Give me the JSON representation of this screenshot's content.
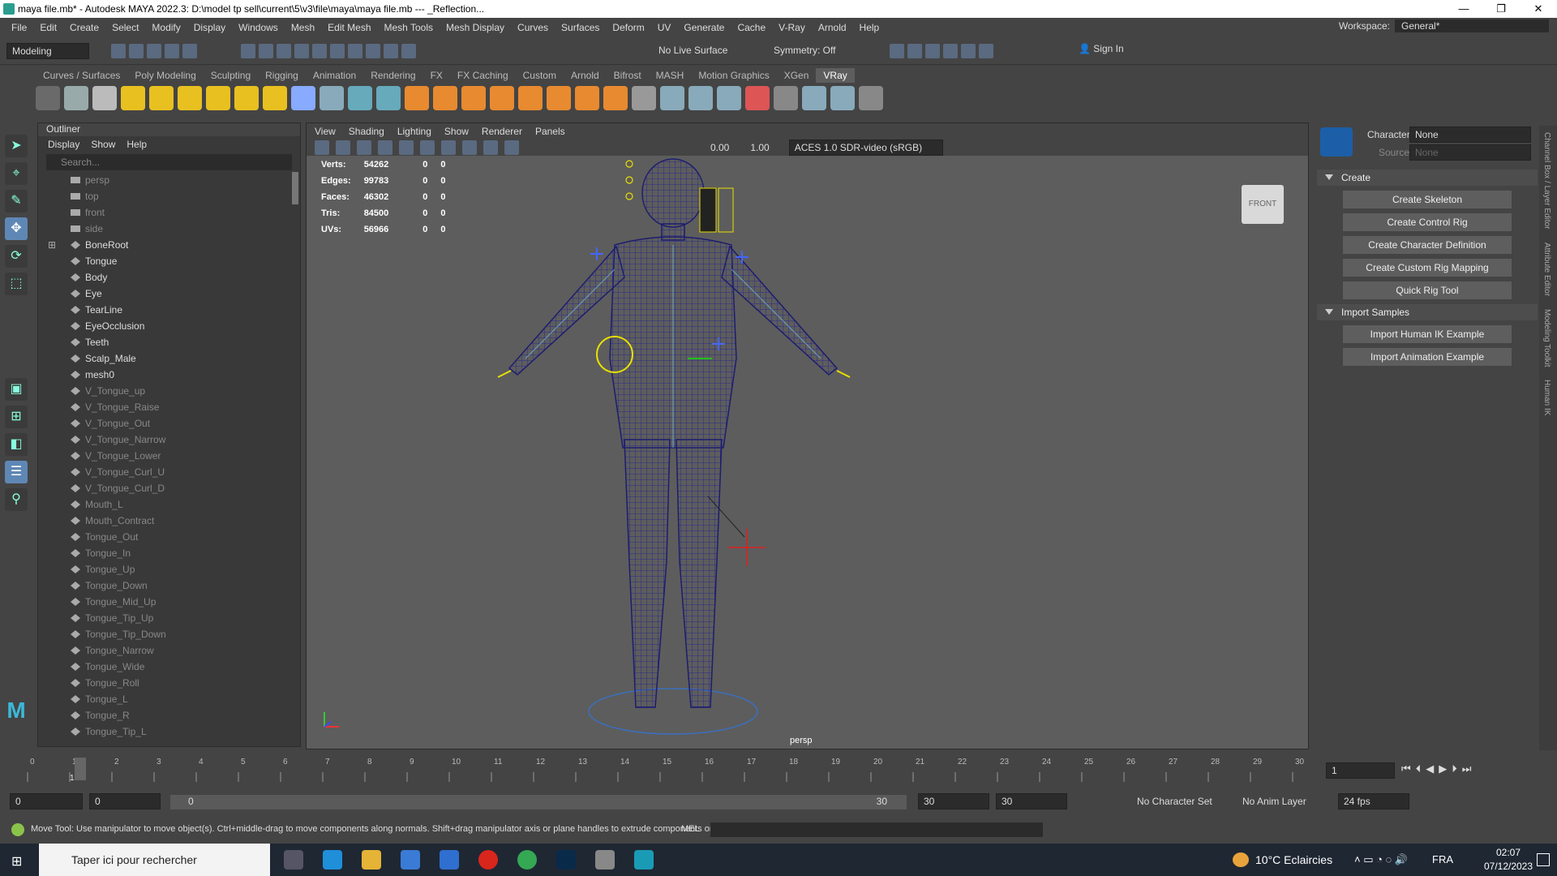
{
  "window": {
    "title": "maya file.mb* - Autodesk MAYA 2022.3: D:\\model tp sell\\current\\5\\v3\\file\\maya\\maya file.mb  ---  _Reflection...",
    "controls": [
      "—",
      "❐",
      "✕"
    ]
  },
  "menubar": {
    "items": [
      "File",
      "Edit",
      "Create",
      "Select",
      "Modify",
      "Display",
      "Windows",
      "Mesh",
      "Edit Mesh",
      "Mesh Tools",
      "Mesh Display",
      "Curves",
      "Surfaces",
      "Deform",
      "UV",
      "Generate",
      "Cache",
      "V-Ray",
      "Arnold",
      "Help"
    ],
    "workspace_label": "Workspace:",
    "workspace_value": "General*"
  },
  "statusline": {
    "mode": "Modeling",
    "live_surface": "No Live Surface",
    "symmetry": "Symmetry: Off",
    "sign_in": "Sign In"
  },
  "shelf": {
    "tabs": [
      "Curves / Surfaces",
      "Poly Modeling",
      "Sculpting",
      "Rigging",
      "Animation",
      "Rendering",
      "FX",
      "FX Caching",
      "Custom",
      "Arnold",
      "Bifrost",
      "MASH",
      "Motion Graphics",
      "XGen",
      "VRay"
    ],
    "active": "VRay"
  },
  "outliner": {
    "title": "Outliner",
    "menu": [
      "Display",
      "Show",
      "Help"
    ],
    "search_placeholder": "Search...",
    "items": [
      {
        "label": "persp",
        "kind": "cam",
        "dim": true
      },
      {
        "label": "top",
        "kind": "cam",
        "dim": true
      },
      {
        "label": "front",
        "kind": "cam",
        "dim": true
      },
      {
        "label": "side",
        "kind": "cam",
        "dim": true
      },
      {
        "label": "BoneRoot",
        "kind": "joint"
      },
      {
        "label": "Tongue",
        "kind": "mesh"
      },
      {
        "label": "Body",
        "kind": "mesh"
      },
      {
        "label": "Eye",
        "kind": "mesh"
      },
      {
        "label": "TearLine",
        "kind": "mesh"
      },
      {
        "label": "EyeOcclusion",
        "kind": "mesh"
      },
      {
        "label": "Teeth",
        "kind": "mesh"
      },
      {
        "label": "Scalp_Male",
        "kind": "mesh"
      },
      {
        "label": "mesh0",
        "kind": "mesh"
      },
      {
        "label": "V_Tongue_up",
        "kind": "mesh",
        "dim": true
      },
      {
        "label": "V_Tongue_Raise",
        "kind": "mesh",
        "dim": true
      },
      {
        "label": "V_Tongue_Out",
        "kind": "mesh",
        "dim": true
      },
      {
        "label": "V_Tongue_Narrow",
        "kind": "mesh",
        "dim": true
      },
      {
        "label": "V_Tongue_Lower",
        "kind": "mesh",
        "dim": true
      },
      {
        "label": "V_Tongue_Curl_U",
        "kind": "mesh",
        "dim": true
      },
      {
        "label": "V_Tongue_Curl_D",
        "kind": "mesh",
        "dim": true
      },
      {
        "label": "Mouth_L",
        "kind": "mesh",
        "dim": true
      },
      {
        "label": "Mouth_Contract",
        "kind": "mesh",
        "dim": true
      },
      {
        "label": "Tongue_Out",
        "kind": "mesh",
        "dim": true
      },
      {
        "label": "Tongue_In",
        "kind": "mesh",
        "dim": true
      },
      {
        "label": "Tongue_Up",
        "kind": "mesh",
        "dim": true
      },
      {
        "label": "Tongue_Down",
        "kind": "mesh",
        "dim": true
      },
      {
        "label": "Tongue_Mid_Up",
        "kind": "mesh",
        "dim": true
      },
      {
        "label": "Tongue_Tip_Up",
        "kind": "mesh",
        "dim": true
      },
      {
        "label": "Tongue_Tip_Down",
        "kind": "mesh",
        "dim": true
      },
      {
        "label": "Tongue_Narrow",
        "kind": "mesh",
        "dim": true
      },
      {
        "label": "Tongue_Wide",
        "kind": "mesh",
        "dim": true
      },
      {
        "label": "Tongue_Roll",
        "kind": "mesh",
        "dim": true
      },
      {
        "label": "Tongue_L",
        "kind": "mesh",
        "dim": true
      },
      {
        "label": "Tongue_R",
        "kind": "mesh",
        "dim": true
      },
      {
        "label": "Tongue_Tip_L",
        "kind": "mesh",
        "dim": true
      }
    ]
  },
  "viewport": {
    "menu": [
      "View",
      "Shading",
      "Lighting",
      "Show",
      "Renderer",
      "Panels"
    ],
    "exposure": "0.00",
    "gamma": "1.00",
    "colorspace": "ACES 1.0 SDR-video (sRGB)",
    "camera_label": "persp",
    "view_cube": "FRONT",
    "stats": [
      [
        "Verts:",
        "54262",
        "0",
        "0"
      ],
      [
        "Edges:",
        "99783",
        "0",
        "0"
      ],
      [
        "Faces:",
        "46302",
        "0",
        "0"
      ],
      [
        "Tris:",
        "84500",
        "0",
        "0"
      ],
      [
        "UVs:",
        "56966",
        "0",
        "0"
      ]
    ]
  },
  "hik": {
    "character_label": "Character:",
    "character_value": "None",
    "source_label": "Source:",
    "source_value": "None",
    "create_title": "Create",
    "create_buttons": [
      "Create Skeleton",
      "Create Control Rig",
      "Create Character Definition",
      "Create Custom Rig Mapping",
      "Quick Rig Tool"
    ],
    "import_title": "Import Samples",
    "import_buttons": [
      "Import Human IK Example",
      "Import Animation Example"
    ],
    "side_tabs": [
      "Channel Box / Layer Editor",
      "Attribute Editor",
      "Modeling Toolkit",
      "Human IK"
    ]
  },
  "timeslider": {
    "ticks": [
      "0",
      "1",
      "2",
      "3",
      "4",
      "5",
      "6",
      "7",
      "8",
      "9",
      "10",
      "11",
      "12",
      "13",
      "14",
      "15",
      "16",
      "17",
      "18",
      "19",
      "20",
      "21",
      "22",
      "23",
      "24",
      "25",
      "26",
      "27",
      "28",
      "29",
      "30"
    ],
    "current": "1",
    "current_field": "1"
  },
  "range": {
    "start": "0",
    "start2": "0",
    "slider_start": "0",
    "slider_end": "30",
    "end": "30",
    "end2": "30",
    "character_set": "No Character Set",
    "anim_layer": "No Anim Layer",
    "fps": "24 fps"
  },
  "help_line": {
    "text": "Move Tool: Use manipulator to move object(s). Ctrl+middle-drag to move components along normals. Shift+drag manipulator axis or plane handles to extrude components or c",
    "mel": "MEL"
  },
  "taskbar": {
    "search": "Taper ici pour rechercher",
    "weather": "10°C  Eclaircies",
    "lang": "FRA",
    "time": "02:07",
    "date": "07/12/2023"
  }
}
